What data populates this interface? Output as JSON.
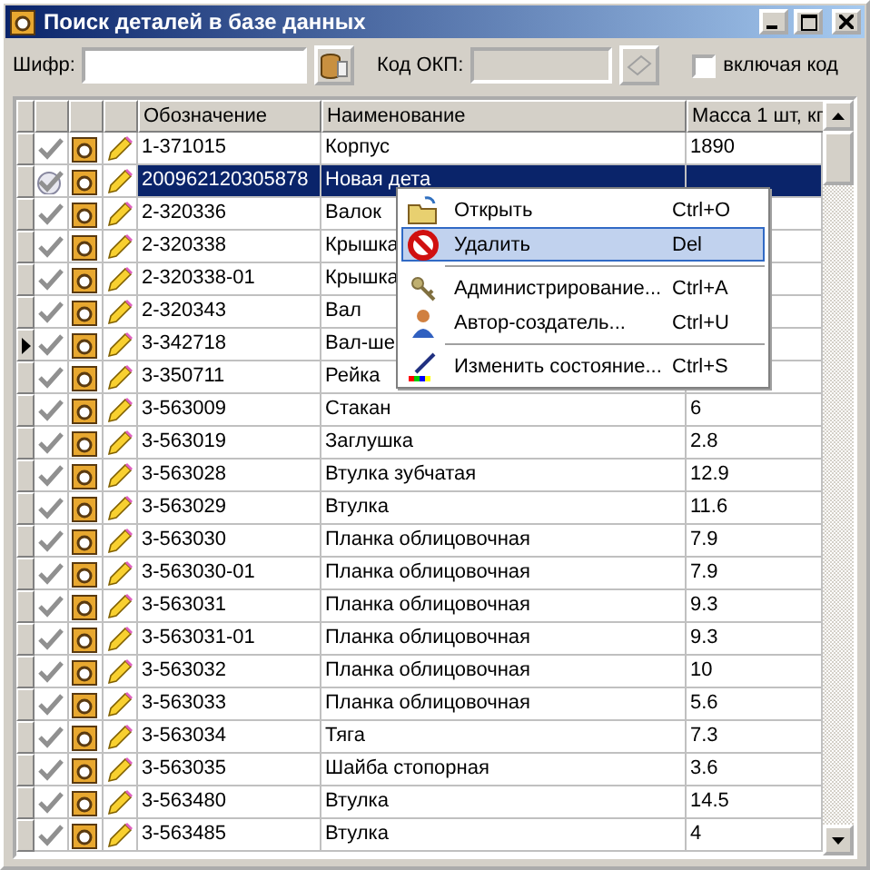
{
  "window": {
    "title": "Поиск деталей в базе данных"
  },
  "filters": {
    "code_label": "Шифр:",
    "okp_label": "Код ОКП:",
    "okp_disabled": true,
    "include_code": {
      "label": "включая код",
      "checked": false
    }
  },
  "table": {
    "columns": [
      "Обозначение",
      "Наименование",
      "Масса 1 шт, кг"
    ],
    "rows": [
      {
        "code": "1-371015",
        "name": "Корпус",
        "mass": "1890",
        "selected": false,
        "current": false
      },
      {
        "code": "200962120305878",
        "name": "Новая дета",
        "mass": "",
        "selected": true,
        "current": false
      },
      {
        "code": "2-320336",
        "name": "Валок",
        "mass": "",
        "selected": false,
        "current": false
      },
      {
        "code": "2-320338",
        "name": "Крышка",
        "mass": "",
        "selected": false,
        "current": false
      },
      {
        "code": "2-320338-01",
        "name": "Крышка",
        "mass": "",
        "selected": false,
        "current": false
      },
      {
        "code": "2-320343",
        "name": "Вал",
        "mass": "",
        "selected": false,
        "current": false
      },
      {
        "code": "3-342718",
        "name": "Вал-ше",
        "mass": "",
        "selected": false,
        "current": true
      },
      {
        "code": "3-350711",
        "name": "Рейка",
        "mass": "",
        "selected": false,
        "current": false
      },
      {
        "code": "3-563009",
        "name": "Стакан",
        "mass": "6",
        "selected": false,
        "current": false
      },
      {
        "code": "3-563019",
        "name": "Заглушка",
        "mass": "2.8",
        "selected": false,
        "current": false
      },
      {
        "code": "3-563028",
        "name": "Втулка зубчатая",
        "mass": "12.9",
        "selected": false,
        "current": false
      },
      {
        "code": "3-563029",
        "name": "Втулка",
        "mass": "11.6",
        "selected": false,
        "current": false
      },
      {
        "code": "3-563030",
        "name": "Планка облицовочная",
        "mass": "7.9",
        "selected": false,
        "current": false
      },
      {
        "code": "3-563030-01",
        "name": "Планка облицовочная",
        "mass": "7.9",
        "selected": false,
        "current": false
      },
      {
        "code": "3-563031",
        "name": "Планка облицовочная",
        "mass": "9.3",
        "selected": false,
        "current": false
      },
      {
        "code": "3-563031-01",
        "name": "Планка облицовочная",
        "mass": "9.3",
        "selected": false,
        "current": false
      },
      {
        "code": "3-563032",
        "name": "Планка облицовочная",
        "mass": "10",
        "selected": false,
        "current": false
      },
      {
        "code": "3-563033",
        "name": "Планка облицовочная",
        "mass": "5.6",
        "selected": false,
        "current": false
      },
      {
        "code": "3-563034",
        "name": "Тяга",
        "mass": "7.3",
        "selected": false,
        "current": false
      },
      {
        "code": "3-563035",
        "name": "Шайба стопорная",
        "mass": "3.6",
        "selected": false,
        "current": false
      },
      {
        "code": "3-563480",
        "name": "Втулка",
        "mass": "14.5",
        "selected": false,
        "current": false
      },
      {
        "code": "3-563485",
        "name": "Втулка",
        "mass": "4",
        "selected": false,
        "current": false
      }
    ]
  },
  "context_menu": [
    {
      "kind": "item",
      "label": "Открыть",
      "shortcut": "Ctrl+O",
      "selected": false
    },
    {
      "kind": "item",
      "label": "Удалить",
      "shortcut": "Del",
      "selected": true
    },
    {
      "kind": "separator"
    },
    {
      "kind": "item",
      "label": "Администрирование...",
      "shortcut": "Ctrl+A",
      "selected": false
    },
    {
      "kind": "item",
      "label": "Автор-создатель...",
      "shortcut": "Ctrl+U",
      "selected": false
    },
    {
      "kind": "separator"
    },
    {
      "kind": "item",
      "label": "Изменить состояние...",
      "shortcut": "Ctrl+S",
      "selected": false
    }
  ]
}
